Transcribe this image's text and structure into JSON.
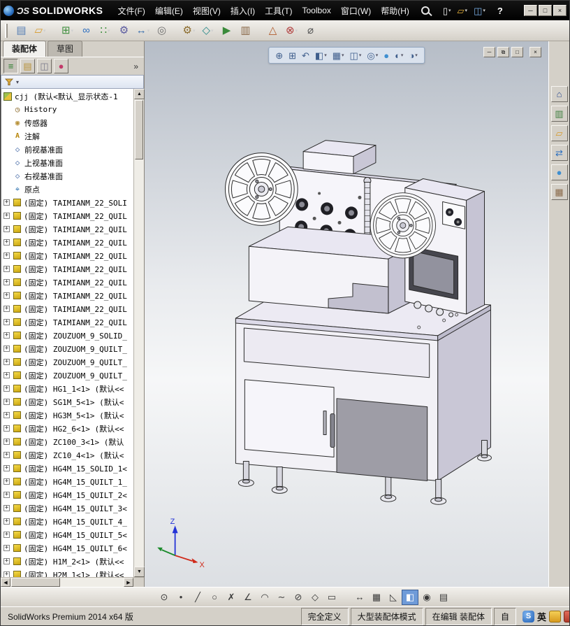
{
  "titlebar": {
    "logo_mark": "ƆS",
    "logo_text": "SOLIDWORKS",
    "menus": [
      "文件(F)",
      "编辑(E)",
      "视图(V)",
      "插入(I)",
      "工具(T)",
      "Toolbox",
      "窗口(W)",
      "帮助(H)"
    ],
    "quick_actions": [
      {
        "name": "new-document",
        "glyph": "▯",
        "color": "#f2f2f2",
        "dd": "▾"
      },
      {
        "name": "open-document",
        "glyph": "▱",
        "color": "#e8b33a",
        "dd": "▾"
      },
      {
        "name": "save-document",
        "glyph": "◫",
        "color": "#7ab0e8",
        "dd": "▾"
      }
    ],
    "help_label": "?",
    "window_buttons": [
      {
        "name": "minimize-window",
        "glyph": "─"
      },
      {
        "name": "maximize-window",
        "glyph": "□"
      },
      {
        "name": "close-window",
        "glyph": "×"
      }
    ]
  },
  "toolbar": {
    "items": [
      {
        "name": "featureworks",
        "glyph": "▤",
        "color": "#5b82b5"
      },
      {
        "name": "open-recent",
        "glyph": "▱",
        "color": "#d79a2b",
        "dd": "▾"
      },
      {
        "name": "insert-components",
        "glyph": "⊞",
        "color": "#3f8f3f",
        "dd": "▾"
      },
      {
        "name": "mate",
        "glyph": "∞",
        "color": "#2f6fbf"
      },
      {
        "name": "linear-component-pattern",
        "glyph": "∷",
        "color": "#3f8f3f",
        "dd": "▾"
      },
      {
        "name": "smart-fasteners",
        "glyph": "⚙",
        "color": "#5a5a9f"
      },
      {
        "name": "move-component",
        "glyph": "↔",
        "color": "#3a6fae",
        "dd": "▾"
      },
      {
        "name": "show-hidden-components",
        "glyph": "◎",
        "color": "#707070"
      },
      {
        "name": "assembly-features",
        "glyph": "⚙",
        "color": "#8a6a2a",
        "dd": "▾"
      },
      {
        "name": "reference-geometry",
        "glyph": "◇",
        "color": "#2a8a8a",
        "dd": "▾"
      },
      {
        "name": "new-motion-study",
        "glyph": "▶",
        "color": "#3a8a3a"
      },
      {
        "name": "bill-of-materials",
        "glyph": "▥",
        "color": "#8a6a4a"
      },
      {
        "name": "exploded-view",
        "glyph": "△",
        "color": "#b05a2a"
      },
      {
        "name": "interference-detection",
        "glyph": "⊗",
        "color": "#b03a3a",
        "dd": "▾"
      },
      {
        "name": "measure",
        "glyph": "⌀",
        "color": "#555555"
      }
    ]
  },
  "left_panel": {
    "tabs": [
      {
        "label": "装配体",
        "active": true
      },
      {
        "label": "草图",
        "active": false
      }
    ],
    "manager_tabs": [
      {
        "name": "featuremanager-design-tree-tab",
        "glyph": "≡",
        "color": "#2f7f2f",
        "active": true
      },
      {
        "name": "propertymanager-tab",
        "glyph": "▤",
        "color": "#b8923a"
      },
      {
        "name": "configurationmanager-tab",
        "glyph": "◫",
        "color": "#7a7a8a"
      },
      {
        "name": "displaymanager-tab",
        "glyph": "●",
        "color": "#c23a6a"
      }
    ],
    "collapse_chevron": "»",
    "filter_dropdown": "▾"
  },
  "tree": {
    "items": [
      {
        "cls": "root",
        "icon": "assembly",
        "label": "cjj (默认<默认_显示状态-1"
      },
      {
        "cls": "child",
        "icon": "history",
        "label": "History"
      },
      {
        "cls": "child",
        "icon": "sensor",
        "label": "传感器"
      },
      {
        "cls": "child",
        "icon": "annotation",
        "label": "注解"
      },
      {
        "cls": "child",
        "icon": "plane",
        "label": "前视基准面"
      },
      {
        "cls": "child",
        "icon": "plane",
        "label": "上视基准面"
      },
      {
        "cls": "child",
        "icon": "plane",
        "label": "右视基准面"
      },
      {
        "cls": "child",
        "icon": "origin",
        "label": "原点"
      },
      {
        "cls": "child",
        "expand": "+",
        "icon": "part",
        "label": "(固定) TAIMIANM_22_SOLI"
      },
      {
        "cls": "child",
        "expand": "+",
        "icon": "part",
        "label": "(固定) TAIMIANM_22_QUIL"
      },
      {
        "cls": "child",
        "expand": "+",
        "icon": "part",
        "label": "(固定) TAIMIANM_22_QUIL"
      },
      {
        "cls": "child",
        "expand": "+",
        "icon": "part",
        "label": "(固定) TAIMIANM_22_QUIL"
      },
      {
        "cls": "child",
        "expand": "+",
        "icon": "part",
        "label": "(固定) TAIMIANM_22_QUIL"
      },
      {
        "cls": "child",
        "expand": "+",
        "icon": "part",
        "label": "(固定) TAIMIANM_22_QUIL"
      },
      {
        "cls": "child",
        "expand": "+",
        "icon": "part",
        "label": "(固定) TAIMIANM_22_QUIL"
      },
      {
        "cls": "child",
        "expand": "+",
        "icon": "part",
        "label": "(固定) TAIMIANM_22_QUIL"
      },
      {
        "cls": "child",
        "expand": "+",
        "icon": "part",
        "label": "(固定) TAIMIANM_22_QUIL"
      },
      {
        "cls": "child",
        "expand": "+",
        "icon": "part",
        "label": "(固定) TAIMIANM_22_QUIL"
      },
      {
        "cls": "child",
        "expand": "+",
        "icon": "part",
        "label": "(固定) ZOUZUOM_9_SOLID_"
      },
      {
        "cls": "child",
        "expand": "+",
        "icon": "part",
        "label": "(固定) ZOUZUOM_9_QUILT_"
      },
      {
        "cls": "child",
        "expand": "+",
        "icon": "part",
        "label": "(固定) ZOUZUOM_9_QUILT_"
      },
      {
        "cls": "child",
        "expand": "+",
        "icon": "part",
        "label": "(固定) ZOUZUOM_9_QUILT_"
      },
      {
        "cls": "child",
        "expand": "+",
        "icon": "part",
        "label": "(固定) HG1_1<1> (默认<<"
      },
      {
        "cls": "child",
        "expand": "+",
        "icon": "part",
        "label": "(固定) SG1M_5<1> (默认<"
      },
      {
        "cls": "child",
        "expand": "+",
        "icon": "part",
        "label": "(固定) HG3M_5<1> (默认<"
      },
      {
        "cls": "child",
        "expand": "+",
        "icon": "part",
        "label": "(固定) HG2_6<1> (默认<<"
      },
      {
        "cls": "child",
        "expand": "+",
        "icon": "part",
        "label": "(固定) ZC100_3<1> (默认"
      },
      {
        "cls": "child",
        "expand": "+",
        "icon": "part",
        "label": "(固定) ZC10_4<1> (默认<"
      },
      {
        "cls": "child",
        "expand": "+",
        "icon": "part",
        "label": "(固定) HG4M_15_SOLID_1<"
      },
      {
        "cls": "child",
        "expand": "+",
        "icon": "part",
        "label": "(固定) HG4M_15_QUILT_1_"
      },
      {
        "cls": "child",
        "expand": "+",
        "icon": "part",
        "label": "(固定) HG4M_15_QUILT_2<"
      },
      {
        "cls": "child",
        "expand": "+",
        "icon": "part",
        "label": "(固定) HG4M_15_QUILT_3<"
      },
      {
        "cls": "child",
        "expand": "+",
        "icon": "part",
        "label": "(固定) HG4M_15_QUILT_4_"
      },
      {
        "cls": "child",
        "expand": "+",
        "icon": "part",
        "label": "(固定) HG4M_15_QUILT_5<"
      },
      {
        "cls": "child",
        "expand": "+",
        "icon": "part",
        "label": "(固定) HG4M_15_QUILT_6<"
      },
      {
        "cls": "child",
        "expand": "+",
        "icon": "part",
        "label": "(固定) H1M_2<1> (默认<<"
      },
      {
        "cls": "child",
        "expand": "+",
        "icon": "part",
        "label": "(固定) H2M_1<1> (默认<<"
      }
    ]
  },
  "scrollbars": {
    "up": "▲",
    "down": "▼",
    "left": "◀",
    "right": "▶"
  },
  "viewport": {
    "hud": [
      {
        "name": "zoom-to-fit",
        "glyph": "⊕"
      },
      {
        "name": "zoom-to-area",
        "glyph": "⊞"
      },
      {
        "name": "previous-view",
        "glyph": "↶"
      },
      {
        "name": "section-view",
        "glyph": "◧",
        "dd": "▾"
      },
      {
        "name": "view-orientation",
        "glyph": "▦",
        "dd": "▾"
      },
      {
        "name": "display-style",
        "glyph": "◫",
        "dd": "▾"
      },
      {
        "name": "hide-show-items",
        "glyph": "◎",
        "dd": "▾"
      },
      {
        "name": "edit-appearance",
        "glyph": "●",
        "color": "#3f8fd0"
      },
      {
        "name": "apply-scene",
        "glyph": "◐",
        "dd": "▾"
      },
      {
        "name": "view-settings",
        "glyph": "◑",
        "dd": "▾"
      }
    ],
    "doc_buttons": [
      {
        "name": "minimize-document",
        "glyph": "─"
      },
      {
        "name": "restore-document",
        "glyph": "⧉"
      },
      {
        "name": "new-window",
        "glyph": "□"
      },
      {
        "name": "close-document",
        "glyph": "×"
      }
    ],
    "triad": {
      "x_label": "X",
      "z_label": "Z"
    }
  },
  "task_pane": {
    "items": [
      {
        "name": "solidworks-resources-tab",
        "glyph": "⌂",
        "color": "#2b4a8f"
      },
      {
        "name": "design-library-tab",
        "glyph": "▥",
        "color": "#3f7f3f"
      },
      {
        "name": "file-explorer-tab",
        "glyph": "▱",
        "color": "#d79a2b"
      },
      {
        "name": "view-palette-tab",
        "glyph": "⇄",
        "color": "#2b6fbf"
      },
      {
        "name": "appearances-scenes-tab",
        "glyph": "●",
        "color": "#3f8fd0"
      },
      {
        "name": "custom-properties-tab",
        "glyph": "▦",
        "color": "#8a6a4a"
      }
    ]
  },
  "sketchbar": {
    "items": [
      {
        "name": "smart-dimension-tool",
        "glyph": "⊙"
      },
      {
        "name": "point-tool",
        "glyph": "•"
      },
      {
        "name": "line-tool",
        "glyph": "╱"
      },
      {
        "name": "circle-tool",
        "glyph": "○"
      },
      {
        "name": "trim-entities-tool",
        "glyph": "✗"
      },
      {
        "name": "sketch-fillet-tool",
        "glyph": "∠"
      },
      {
        "name": "arc-tool",
        "glyph": "◠"
      },
      {
        "name": "spline-tool",
        "glyph": "∼"
      },
      {
        "name": "ellipse-tool",
        "glyph": "⊘"
      },
      {
        "name": "polygon-tool",
        "glyph": "◇"
      },
      {
        "name": "rectangle-tool",
        "glyph": "▭"
      },
      {
        "name": "horizontal-dimension-tool",
        "glyph": "↔"
      },
      {
        "name": "grid-snap-toggle",
        "glyph": "▦"
      },
      {
        "name": "angle-snap-toggle",
        "glyph": "◺"
      },
      {
        "name": "shaded-sketch-contours-toggle",
        "glyph": "◧",
        "active": true
      },
      {
        "name": "quick-snaps-toggle",
        "glyph": "◉"
      },
      {
        "name": "grid-settings",
        "glyph": "▤"
      }
    ]
  },
  "statusbar": {
    "app_version": "SolidWorks Premium 2014 x64 版",
    "cells": [
      "完全定义",
      "大型装配体模式",
      "在编辑 装配体",
      "自"
    ],
    "ime": {
      "badge": "S",
      "lang": "英"
    }
  }
}
